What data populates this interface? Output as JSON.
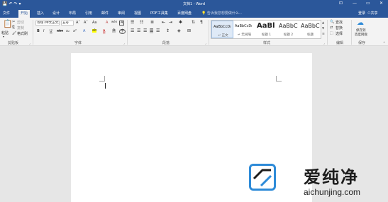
{
  "window": {
    "title": "文档1 - Word",
    "qat_icons": [
      "save-icon",
      "undo-icon",
      "redo-icon",
      "customize-qat-icon"
    ],
    "controls": [
      "ribbon-display-icon",
      "minimize-icon",
      "maximize-icon",
      "close-icon"
    ],
    "control_glyphs": [
      "⊡",
      "—",
      "▭",
      "✕"
    ]
  },
  "tabs": [
    {
      "label": "文件"
    },
    {
      "label": "开始",
      "active": true
    },
    {
      "label": "插入"
    },
    {
      "label": "设计"
    },
    {
      "label": "布局"
    },
    {
      "label": "引用"
    },
    {
      "label": "邮件"
    },
    {
      "label": "审阅"
    },
    {
      "label": "视图"
    },
    {
      "label": "PDF工具集"
    },
    {
      "label": "百度网盘"
    }
  ],
  "tellme": {
    "placeholder": "告诉我您想要做什么..."
  },
  "account": {
    "signin": "登录",
    "share": "共享"
  },
  "ribbon": {
    "clipboard": {
      "label": "剪贴板",
      "paste": "粘贴",
      "cut": "剪切",
      "copy": "复制",
      "format_painter": "格式刷"
    },
    "font": {
      "label": "字体",
      "font_name": "等线 (中文正文)",
      "font_size": "五号",
      "grow": "A˄",
      "shrink": "A˅",
      "case": "Aa",
      "clear": "A",
      "wen": "wén",
      "border_char": "A",
      "bold": "B",
      "italic": "I",
      "underline": "U",
      "strike": "abc",
      "subscript": "x₂",
      "superscript": "x²",
      "effects": "A",
      "highlight": "ab",
      "font_color": "A",
      "shading": "A",
      "enclose": "字"
    },
    "paragraph": {
      "label": "段落"
    },
    "styles": {
      "label": "样式",
      "items": [
        {
          "sample": "AaBbCcDı",
          "name": "↵ 正文"
        },
        {
          "sample": "AaBbCcDı",
          "name": "↵ 无间隔"
        },
        {
          "sample": "AaBl",
          "name": "标题 1"
        },
        {
          "sample": "AaBbC",
          "name": "标题 2"
        },
        {
          "sample": "AaBbC",
          "name": "标题"
        }
      ]
    },
    "editing": {
      "label": "编辑",
      "find": "查找",
      "replace": "替换",
      "select": "选择"
    },
    "save": {
      "label": "保存",
      "button": "保存到",
      "button2": "百度网盘"
    }
  },
  "watermark": {
    "title": "爱纯净",
    "url": "aichunjing.com"
  }
}
